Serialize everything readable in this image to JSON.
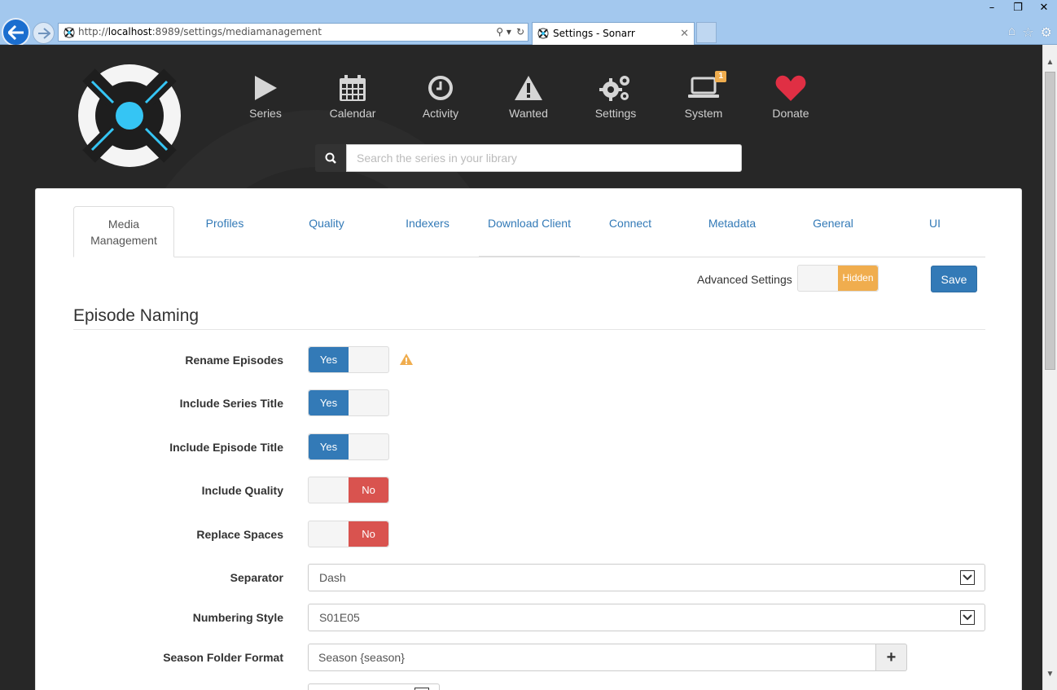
{
  "browser": {
    "url_prefix": "http://",
    "url_host": "localhost",
    "url_rest": ":8989/settings/mediamanagement",
    "tab_title": "Settings - Sonarr"
  },
  "nav": {
    "series": "Series",
    "calendar": "Calendar",
    "activity": "Activity",
    "wanted": "Wanted",
    "settings": "Settings",
    "system": "System",
    "system_badge": "1",
    "donate": "Donate"
  },
  "search": {
    "placeholder": "Search the series in your library"
  },
  "tabs": {
    "media_management": "Media Management",
    "profiles": "Profiles",
    "quality": "Quality",
    "indexers": "Indexers",
    "download_client": "Download Client",
    "connect": "Connect",
    "metadata": "Metadata",
    "general": "General",
    "ui": "UI"
  },
  "toolbar": {
    "advanced_label": "Advanced Settings",
    "advanced_state": "Hidden",
    "save_label": "Save"
  },
  "section": {
    "title": "Episode Naming"
  },
  "fields": {
    "rename_episodes": {
      "label": "Rename Episodes",
      "state": "Yes"
    },
    "include_series_title": {
      "label": "Include Series Title",
      "state": "Yes"
    },
    "include_episode_title": {
      "label": "Include Episode Title",
      "state": "Yes"
    },
    "include_quality": {
      "label": "Include Quality",
      "state": "No"
    },
    "replace_spaces": {
      "label": "Replace Spaces",
      "state": "No"
    },
    "separator": {
      "label": "Separator",
      "value": "Dash"
    },
    "numbering_style": {
      "label": "Numbering Style",
      "value": "S01E05"
    },
    "season_folder_format": {
      "label": "Season Folder Format",
      "value": "Season {season}",
      "addon": "+"
    }
  },
  "colors": {
    "primary": "#337ab7",
    "danger": "#d9534f",
    "warning": "#f0ad4e",
    "header_bg": "#272727",
    "donate_heart": "#e02f44"
  }
}
